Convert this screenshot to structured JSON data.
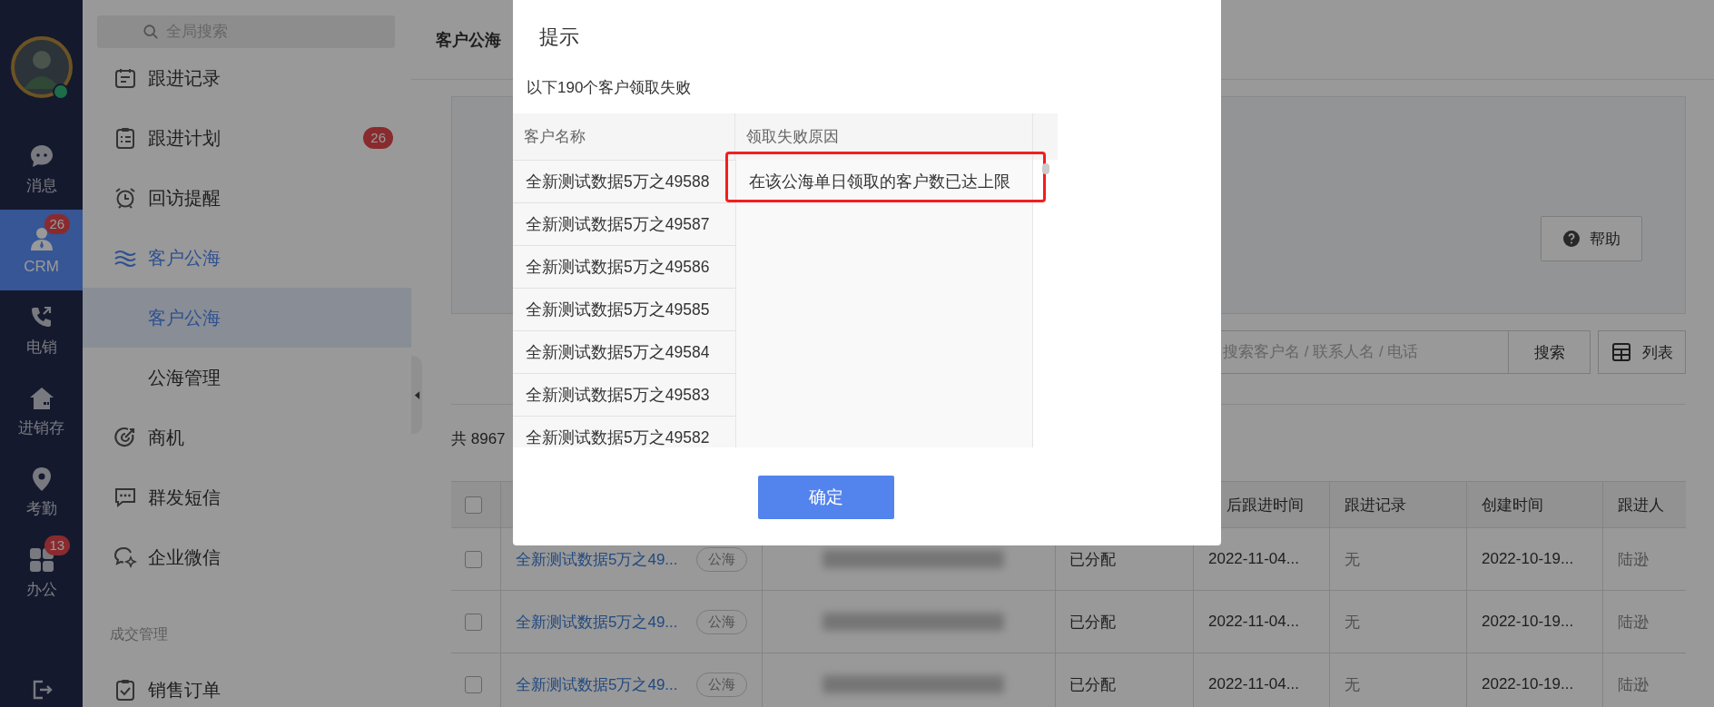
{
  "rail": {
    "items": [
      {
        "label": "消息",
        "selected": false
      },
      {
        "label": "CRM",
        "selected": true,
        "badge": "26"
      },
      {
        "label": "电销",
        "selected": false
      },
      {
        "label": "进销存",
        "selected": false
      },
      {
        "label": "考勤",
        "selected": false
      },
      {
        "label": "办公",
        "selected": false,
        "badge": "13"
      }
    ]
  },
  "sidebar": {
    "search": {
      "placeholder": "全局搜索"
    },
    "items": [
      {
        "label": "跟进记录",
        "selected": false
      },
      {
        "label": "跟进计划",
        "selected": false,
        "badge": "26"
      },
      {
        "label": "回访提醒",
        "selected": false
      },
      {
        "label": "客户公海",
        "selected": true,
        "expanded": true,
        "children": [
          {
            "label": "客户公海",
            "selected": true
          },
          {
            "label": "公海管理",
            "selected": false
          }
        ]
      },
      {
        "label": "商机",
        "selected": false
      },
      {
        "label": "群发短信",
        "selected": false
      },
      {
        "label": "企业微信",
        "selected": false
      }
    ],
    "sections": [
      {
        "title": "成交管理",
        "items": [
          {
            "label": "销售订单",
            "selected": false
          }
        ]
      }
    ]
  },
  "main": {
    "title": "客户公海",
    "help_button": "帮助",
    "search": {
      "placeholder": "搜索客户名 / 联系人名 / 电话"
    },
    "search_button": "搜索",
    "view_button": "列表",
    "total": "共 8967"
  },
  "table": {
    "header_checked": false,
    "columns": [
      "后跟进时间",
      "跟进记录",
      "创建时间",
      "跟进人"
    ],
    "rows": [
      {
        "checked": false,
        "name": "全新测试数据5万之49...",
        "tag": "公海",
        "status": "已分配",
        "last_follow": "2022-11-04...",
        "record": "无",
        "created": "2022-10-19...",
        "owner": "陆逊"
      },
      {
        "checked": false,
        "name": "全新测试数据5万之49...",
        "tag": "公海",
        "status": "已分配",
        "last_follow": "2022-11-04...",
        "record": "无",
        "created": "2022-10-19...",
        "owner": "陆逊"
      },
      {
        "checked": false,
        "name": "全新测试数据5万之49...",
        "tag": "公海",
        "status": "已分配",
        "last_follow": "2022-11-04...",
        "record": "无",
        "created": "2022-10-19...",
        "owner": "陆逊"
      }
    ]
  },
  "dialog": {
    "title": "提示",
    "message": "以下190个客户领取失败",
    "columns": [
      "客户名称",
      "领取失败原因"
    ],
    "rows": [
      {
        "name": "全新测试数据5万之49588",
        "reason": "在该公海单日领取的客户数已达上限",
        "highlighted": true
      },
      {
        "name": "全新测试数据5万之49587",
        "highlighted": false
      },
      {
        "name": "全新测试数据5万之49586",
        "highlighted": false
      },
      {
        "name": "全新测试数据5万之49585",
        "highlighted": false
      },
      {
        "name": "全新测试数据5万之49584",
        "highlighted": false
      },
      {
        "name": "全新测试数据5万之49583",
        "highlighted": false
      },
      {
        "name": "全新测试数据5万之49582",
        "highlighted": false
      }
    ],
    "confirm_button": "确定"
  }
}
